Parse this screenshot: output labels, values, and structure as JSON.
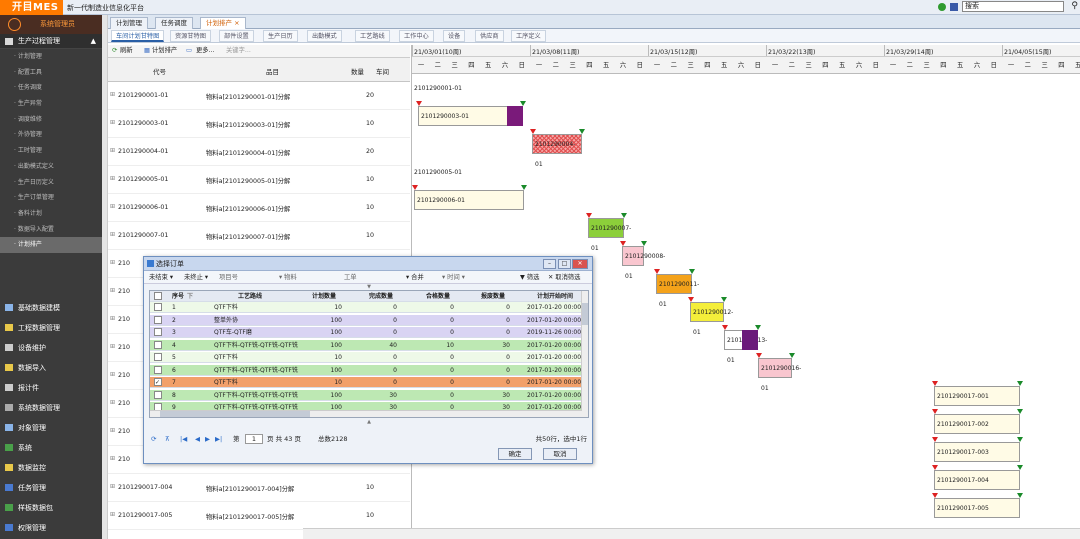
{
  "app": {
    "logo": "开目MES",
    "title": "新一代制造业信息化平台",
    "search_placeholder": "搜索"
  },
  "user": {
    "name": "系统管理员"
  },
  "sidebar": {
    "section1": "生产过程管理",
    "items": [
      "· 计划管理",
      "· 配置工具",
      "· 任务调度",
      "· 生产异常",
      "· 调度维修",
      "· 外协管理",
      "· 工时管理",
      "· 出勤模式定义",
      "· 生产日历定义",
      "· 生产订单管理",
      "· 备料计划",
      "· 数据导入配置",
      "· 计划排产"
    ],
    "sections": [
      "基础数据建模",
      "工程数据管理",
      "设备维护",
      "数据导入",
      "报计件",
      "系统数据管理",
      "对象管理",
      "系统",
      "数据监控",
      "任务管理",
      "样板数据包",
      "权限管理"
    ]
  },
  "tabs": [
    "计划管理",
    "任务调度",
    "计划排产"
  ],
  "subtabs": [
    "车间计划甘特图",
    "资源甘特图",
    "部件设置",
    "生产日历",
    "出勤模式",
    "工艺路线",
    "工作中心",
    "设备",
    "供应商",
    "工序定义"
  ],
  "toolbar": {
    "refresh": "刷新",
    "plan": "计划排产",
    "more": "更多...",
    "keyword": "关键字..."
  },
  "grid": {
    "headers": [
      "代号",
      "品目",
      "数量",
      "车间"
    ],
    "rows": [
      {
        "code": "2101290001-01",
        "item": "物料a[2101290001-01]分解",
        "qty": "20"
      },
      {
        "code": "2101290003-01",
        "item": "物料a[2101290003-01]分解",
        "qty": "10"
      },
      {
        "code": "2101290004-01",
        "item": "物料a[2101290004-01]分解",
        "qty": "20"
      },
      {
        "code": "2101290005-01",
        "item": "物料a[2101290005-01]分解",
        "qty": "10"
      },
      {
        "code": "2101290006-01",
        "item": "物料a[2101290006-01]分解",
        "qty": "10"
      },
      {
        "code": "2101290007-01",
        "item": "物料a[2101290007-01]分解",
        "qty": "10"
      },
      {
        "code": "210",
        "item": "",
        "qty": ""
      },
      {
        "code": "210",
        "item": "",
        "qty": ""
      },
      {
        "code": "210",
        "item": "",
        "qty": ""
      },
      {
        "code": "210",
        "item": "",
        "qty": ""
      },
      {
        "code": "210",
        "item": "",
        "qty": ""
      },
      {
        "code": "210",
        "item": "",
        "qty": ""
      },
      {
        "code": "210",
        "item": "",
        "qty": ""
      },
      {
        "code": "210",
        "item": "",
        "qty": ""
      },
      {
        "code": "2101290017-004",
        "item": "物料a[2101290017-004]分解",
        "qty": "10"
      },
      {
        "code": "2101290017-005",
        "item": "物料a[2101290017-005]分解",
        "qty": "10"
      }
    ]
  },
  "gantt": {
    "weeks": [
      "21/03/01(10周)",
      "21/03/08(11周)",
      "21/03/15(12周)",
      "21/03/22(13周)",
      "21/03/29(14周)",
      "21/04/05(15周)"
    ],
    "days": [
      "一",
      "二",
      "三",
      "四",
      "五",
      "六",
      "日"
    ],
    "labels": [
      "2101290001-01",
      "2101290003-01",
      "2101290004-01",
      "2101290005-01",
      "2101290006-01",
      "2101290007-01",
      "2101290008-01",
      "2101290011-01",
      "2101290012-01",
      "2101290013-01",
      "2101290016-01",
      "2101290017-001",
      "2101290017-002",
      "2101290017-003",
      "2101290017-004",
      "2101290017-005"
    ]
  },
  "dialog": {
    "title": "选择订单",
    "filter": {
      "status": "未结束",
      "status2": "未终止",
      "item": "项目号",
      "material": "物料",
      "order": "工单",
      "mode": "合并",
      "time": "时间",
      "filter_btn": "筛选",
      "clear_btn": "取消筛选"
    },
    "headers": [
      "序号",
      "工艺路线",
      "计划数量",
      "完成数量",
      "合格数量",
      "报废数量",
      "计划开始时间"
    ],
    "rows": [
      {
        "n": "1",
        "route": "QTF下料",
        "plan": "10",
        "done": "0",
        "ok": "0",
        "scrap": "0",
        "start": "2017-01-20 00:00"
      },
      {
        "n": "2",
        "route": "整单外协",
        "plan": "100",
        "done": "0",
        "ok": "0",
        "scrap": "0",
        "start": "2017-01-20 00:00"
      },
      {
        "n": "3",
        "route": "QTF车-QTF磨",
        "plan": "100",
        "done": "0",
        "ok": "0",
        "scrap": "0",
        "start": "2019-11-26 00:00"
      },
      {
        "n": "4",
        "route": "QTF下料-QTF铣-QTF铣-QTF铣",
        "plan": "100",
        "done": "40",
        "ok": "10",
        "scrap": "30",
        "start": "2017-01-20 00:00"
      },
      {
        "n": "5",
        "route": "QTF下料",
        "plan": "10",
        "done": "0",
        "ok": "0",
        "scrap": "0",
        "start": "2017-01-20 00:00"
      },
      {
        "n": "6",
        "route": "QTF下料-QTF铣-QTF铣-QTF铣",
        "plan": "100",
        "done": "0",
        "ok": "0",
        "scrap": "0",
        "start": "2017-01-20 00:00"
      },
      {
        "n": "7",
        "route": "QTF下料",
        "plan": "10",
        "done": "0",
        "ok": "0",
        "scrap": "0",
        "start": "2017-01-20 00:00"
      },
      {
        "n": "8",
        "route": "QTF下料-QTF铣-QTF铣-QTF铣",
        "plan": "100",
        "done": "30",
        "ok": "0",
        "scrap": "30",
        "start": "2017-01-20 00:00"
      },
      {
        "n": "9",
        "route": "QTF下料-QTF铣-QTF铣-QTF铣",
        "plan": "100",
        "done": "30",
        "ok": "0",
        "scrap": "30",
        "start": "2017-01-20 00:00"
      }
    ],
    "pager": {
      "page_label": "第",
      "page": "1",
      "of": "页 共 43 页",
      "total": "总数2128",
      "summary": "共50行，选中1行"
    },
    "ok": "确定",
    "cancel": "取消"
  }
}
